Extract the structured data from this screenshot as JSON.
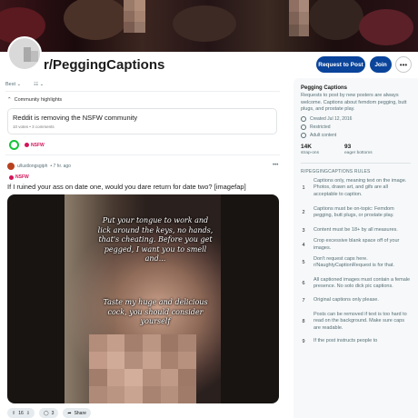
{
  "header": {
    "subreddit": "r/PeggingCaptions",
    "request_button": "Request to Post",
    "join_button": "Join",
    "more_icon": "ellipsis-icon"
  },
  "sortbar": {
    "sort_label": "Best",
    "view_icon": "layout-icon"
  },
  "highlights": {
    "heading": "Community highlights",
    "card_title": "Reddit is removing the NSFW community",
    "card_meta": "10 votes • 3 comments",
    "tag": "NSFW"
  },
  "post": {
    "author": "u/lustlongsgiph",
    "age": "• 7 hr. ago",
    "tag": "NSFW",
    "title": "If I ruined your ass on date one, would you dare return for date two? [imagefap]",
    "caption_top": "Put your tongue to work and lick around the keys, no hands, that's cheating. Before you get pegged, I want you to smell and...",
    "caption_bottom": "Taste my huge and delicious cock, you should consider yourself",
    "votes": "16",
    "comments": "3",
    "share": "Share"
  },
  "sidebar": {
    "name": "Pegging Captions",
    "description": "Requests to post by new posters are always welcome. Captions about femdom pegging, butt plugs, and prostate play.",
    "created": "Created Jul 12, 2016",
    "restricted": "Restricted",
    "adult": "Adult content",
    "members_value": "14K",
    "members_label": "strap-ons",
    "online_value": "93",
    "online_label": "eager bottoms",
    "rules_heading": "R/PEGGINGCAPTIONS RULES",
    "rules": [
      {
        "n": "1",
        "text": "Captions only, meaning text on the image. Photos, drawn art, and gifs are all acceptable to caption."
      },
      {
        "n": "2",
        "text": "Captions must be on-topic: Femdom pegging, butt plugs, or prostate play."
      },
      {
        "n": "3",
        "text": "Content must be 18+ by all measures."
      },
      {
        "n": "4",
        "text": "Crop excessive blank space off of your images."
      },
      {
        "n": "5",
        "text": "Don't request caps here. r/NaughtyCaptionRequest is for that."
      },
      {
        "n": "6",
        "text": "All captioned images must contain a female presence. No solo dick pic captions."
      },
      {
        "n": "7",
        "text": "Original captions only please."
      },
      {
        "n": "8",
        "text": "Posts can be removed if text is too hard to read on the background. Make sure caps are readable."
      },
      {
        "n": "9",
        "text": "If the post instructs people to"
      }
    ]
  },
  "colors": {
    "accent": "#0a449b",
    "nsfw": "#d4145a",
    "online": "#18c23b"
  }
}
